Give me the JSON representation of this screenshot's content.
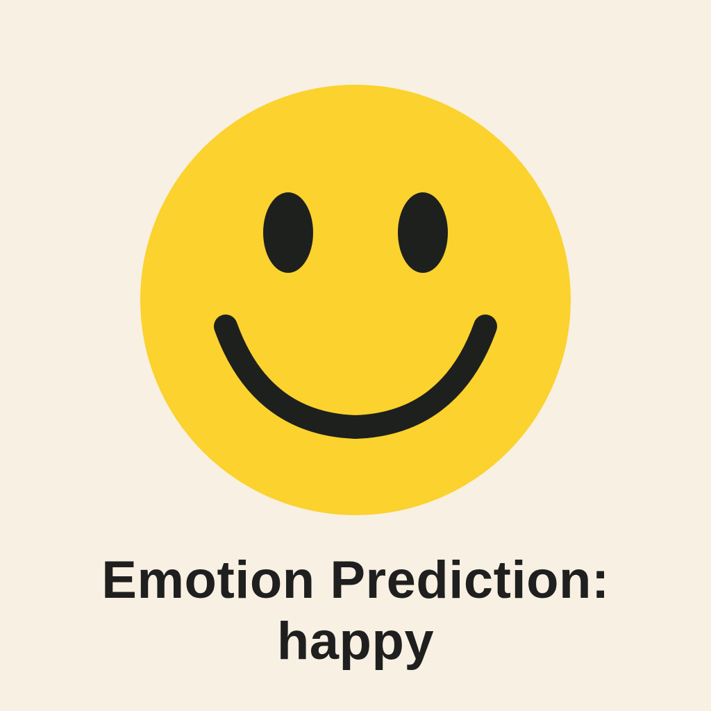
{
  "prediction": {
    "label": "Emotion Prediction:",
    "value": "happy"
  },
  "face": {
    "icon": "smiley-face-icon",
    "expression": "happy"
  },
  "colors": {
    "background": "#f8f0e2",
    "face_fill": "#fbd22e",
    "feature": "#1e201e",
    "text": "#1f1f1f"
  }
}
